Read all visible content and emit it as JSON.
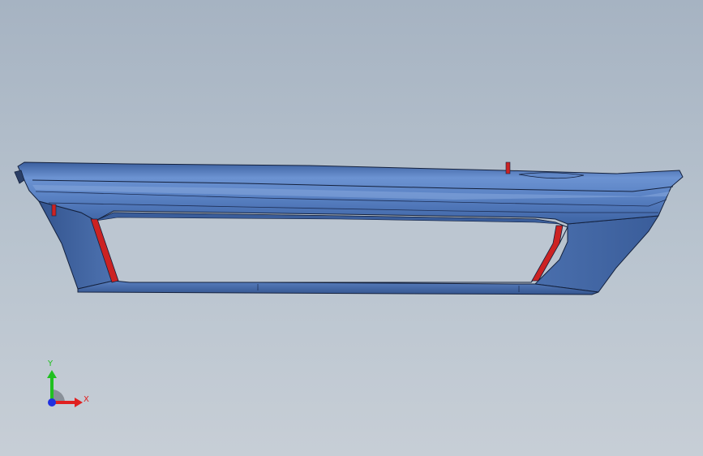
{
  "viewport": {
    "background_top": "#a6b3c2",
    "background_bottom": "#c7ced6"
  },
  "model": {
    "part": "bumper",
    "body_color": "#4d73b0",
    "body_dark_color": "#2f4f86",
    "edge_color": "#14213d",
    "highlight_color": "#8fb0e0",
    "accent_color": "#cc2222"
  },
  "triad": {
    "x_label": "X",
    "y_label": "Y",
    "x_color": "#e02020",
    "y_color": "#20c020",
    "z_color": "#2030e0"
  }
}
